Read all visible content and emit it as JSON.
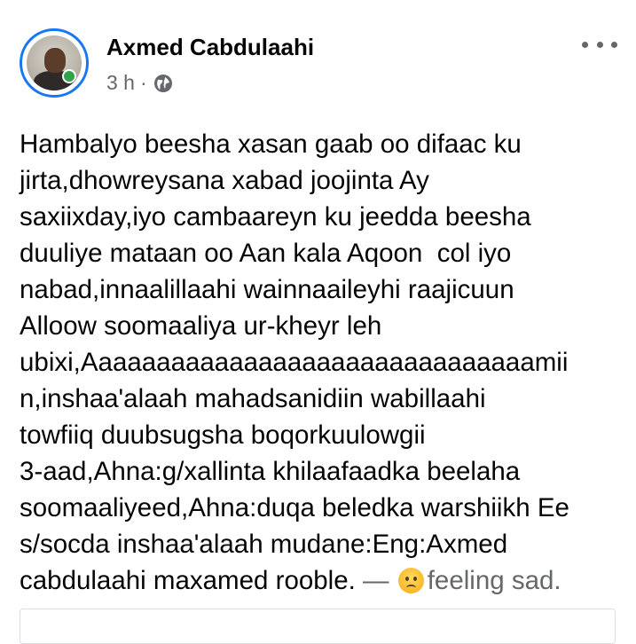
{
  "post": {
    "author": "Axmed Cabdulaahi",
    "time": "3 h",
    "separator": "·",
    "audience_icon": "globe-icon",
    "more_icon": "more-options-icon",
    "body_lines": [
      "Hambalyo beesha xasan gaab oo difaac ku",
      "jirta,dhowreysana xabad joojinta Ay",
      "saxiixday,iyo cambaareyn ku jeedda beesha",
      "duuliye mataan oo Aan kala Aqoon  col iyo",
      "nabad,innaalillaahi wainnaaileyhi raajicuun",
      "Alloow soomaaliya ur-kheyr leh",
      "ubixi,Aaaaaaaaaaaaaaaaaaaaaaaaaaaaaaamii",
      "n,inshaa'alaah mahadsanidiin wabillaahi",
      "towfiiq duubsugsha boqorkuulowgii",
      "3-aad,Ahna:g/xallinta khilaafaadka beelaha",
      "soomaaliyeed,Ahna:duqa beledka warshiikh Ee",
      "s/socda inshaa'alaah mudane:Eng:Axmed"
    ],
    "last_line_text": "cabdulaahi maxamed rooble.",
    "feeling_dash": " — ",
    "feeling_emoji": "sad-face-emoji",
    "feeling_text": "feeling sad."
  },
  "colors": {
    "avatar_ring": "#1877f2",
    "text_primary": "#050505",
    "text_secondary": "#65676b",
    "online_badge": "#31a24c"
  }
}
